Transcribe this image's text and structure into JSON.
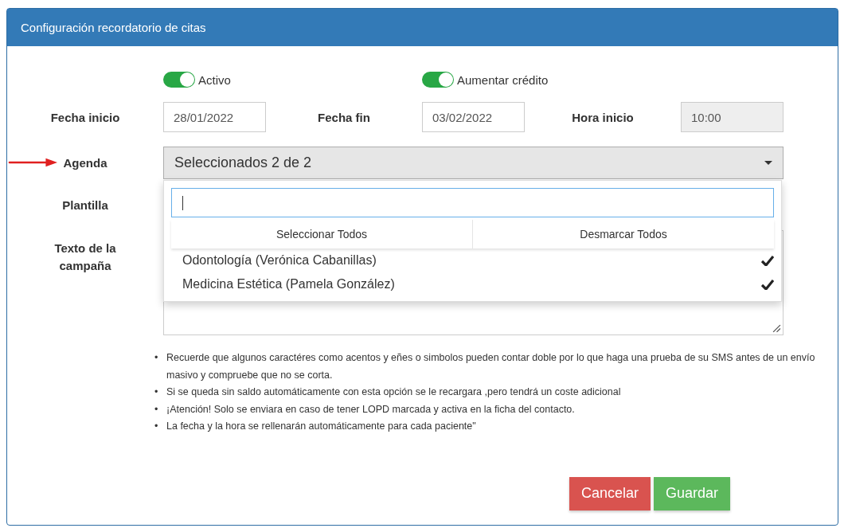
{
  "panel": {
    "title": "Configuración recordatorio de citas"
  },
  "toggles": [
    {
      "label": "Activo",
      "on": true
    },
    {
      "label": "Aumentar crédito",
      "on": true
    }
  ],
  "date_row": [
    {
      "label": "Fecha inicio",
      "value": "28/01/2022",
      "disabled": false
    },
    {
      "label": "Fecha fin",
      "value": "03/02/2022",
      "disabled": false
    },
    {
      "label": "Hora inicio",
      "value": "10:00",
      "disabled": true
    }
  ],
  "agenda": {
    "label": "Agenda",
    "value": "Seleccionados 2 de 2",
    "expanded": true,
    "dropdown": {
      "actions": [
        "Seleccionar Todos",
        "Desmarcar Todos"
      ],
      "options": [
        {
          "label": "Odontología (Verónica Cabanillas)",
          "checked": true
        },
        {
          "label": "Medicina Estética (Pamela González)",
          "checked": true
        }
      ]
    }
  },
  "plantilla": {
    "label": "Plantilla"
  },
  "campaign_text": {
    "label": "Texto de la campaña"
  },
  "notes": [
    {
      "bullet": "•",
      "text": "Recuerde que algunos caractéres como acentos y eñes o simbolos pueden contar doble por lo que haga una prueba de su SMS antes de un envío masivo y compruebe que no se corta."
    },
    {
      "bullet": "•",
      "text": "Si se queda sin saldo automáticamente con esta opción se le recargara ,pero tendrá un coste adicional"
    },
    {
      "bullet": "•",
      "text": "¡Atención! Solo se enviara en caso de tener LOPD marcada y activa en la ficha del contacto."
    },
    {
      "bullet": "•",
      "text": "La fecha y la hora se rellenarán automáticamente para cada paciente\""
    }
  ],
  "buttons": [
    {
      "label": "Cancelar",
      "kind": "danger"
    },
    {
      "label": "Guardar",
      "kind": "success"
    }
  ]
}
